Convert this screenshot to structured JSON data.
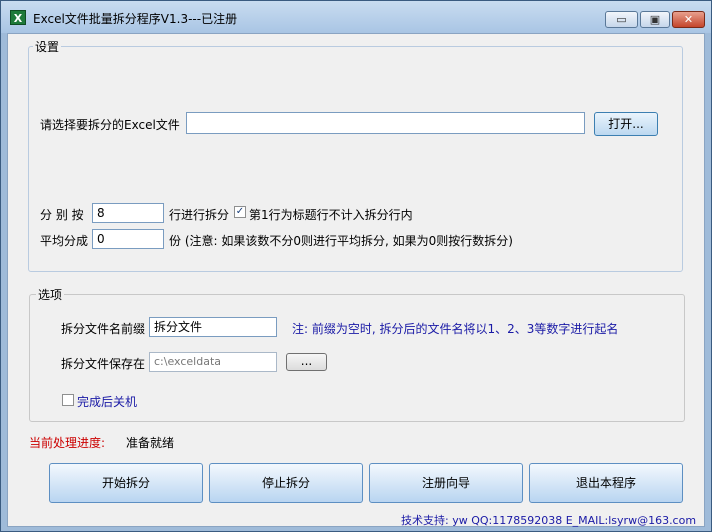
{
  "window": {
    "title": "Excel文件批量拆分程序V1.3---已注册",
    "app_icon_glyph": "X",
    "minimize_glyph": "▭",
    "maximize_glyph": "▣",
    "close_glyph": "✕"
  },
  "settings": {
    "caption": "设置",
    "file_label": "请选择要拆分的Excel文件",
    "file_value": "",
    "open_button": "打开...",
    "split_by_label": "分 别 按",
    "split_by_value": "8",
    "split_by_suffix": "行进行拆分",
    "header_checkbox_checked": true,
    "header_checkbox_label": "第1行为标题行不计入拆分行内",
    "average_label": "平均分成",
    "average_value": "0",
    "average_note": "份 (注意: 如果该数不分0则进行平均拆分, 如果为0则按行数拆分)"
  },
  "options": {
    "caption": "选项",
    "prefix_label": "拆分文件名前缀",
    "prefix_value": "拆分文件",
    "prefix_note": "注: 前缀为空时, 拆分后的文件名将以1、2、3等数字进行起名",
    "save_label": "拆分文件保存在",
    "save_value": "c:\\exceldata",
    "browse_button": "...",
    "shutdown_checked": false,
    "shutdown_label": "完成后关机"
  },
  "status": {
    "label": "当前处理进度:",
    "value": "准备就绪"
  },
  "actions": {
    "start": "开始拆分",
    "stop": "停止拆分",
    "register": "注册向导",
    "exit": "退出本程序"
  },
  "footer": {
    "support": "技术支持: yw  QQ:1178592038  E_MAIL:lsyrw@163.com"
  },
  "colors": {
    "status_label": "#cc0000",
    "note_text": "#1a1aa6",
    "footer_text": "#1a1aa6"
  }
}
